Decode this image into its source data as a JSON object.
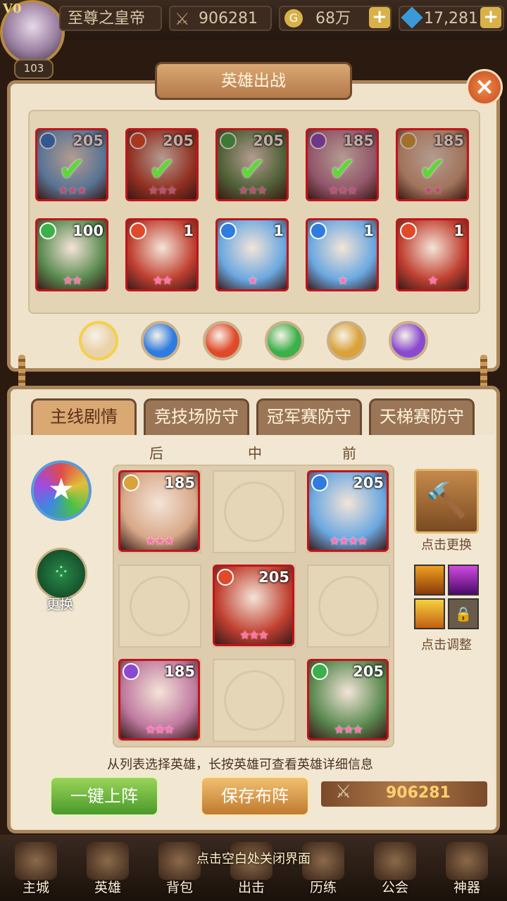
{
  "header": {
    "vip": "V0",
    "player_level": "103",
    "player_name": "至尊之皇帝",
    "power": "906281",
    "gold": "68万",
    "gems": "17,281"
  },
  "dialog": {
    "title": "英雄出战",
    "roster": [
      {
        "level": "205",
        "element": "water",
        "stars": "★★★",
        "deployed": true
      },
      {
        "level": "205",
        "element": "fire",
        "stars": "★★★",
        "deployed": true
      },
      {
        "level": "205",
        "element": "wind",
        "stars": "★★★",
        "deployed": true
      },
      {
        "level": "185",
        "element": "dark",
        "stars": "★★★",
        "deployed": true
      },
      {
        "level": "185",
        "element": "light",
        "stars": "★★",
        "deployed": true
      },
      {
        "level": "100",
        "element": "wind",
        "stars": "★★",
        "deployed": false
      },
      {
        "level": "1",
        "element": "fire",
        "stars": "★★",
        "deployed": false
      },
      {
        "level": "1",
        "element": "water",
        "stars": "★",
        "deployed": false
      },
      {
        "level": "1",
        "element": "water",
        "stars": "★",
        "deployed": false
      },
      {
        "level": "1",
        "element": "fire",
        "stars": "★",
        "deployed": false
      }
    ],
    "filters": [
      "all",
      "water",
      "fire",
      "wind",
      "light",
      "dark"
    ]
  },
  "formation": {
    "tabs": [
      "主线剧情",
      "竞技场防守",
      "冠军赛防守",
      "天梯赛防守"
    ],
    "active_tab": 0,
    "columns": [
      "后",
      "中",
      "前"
    ],
    "grid": [
      {
        "level": "185",
        "element": "light",
        "stars": "★★★"
      },
      null,
      {
        "level": "205",
        "element": "water",
        "stars": "★★★★"
      },
      null,
      {
        "level": "205",
        "element": "fire",
        "stars": "★★★"
      },
      null,
      {
        "level": "185",
        "element": "dark",
        "stars": "★★★"
      },
      null,
      {
        "level": "205",
        "element": "wind",
        "stars": "★★★"
      }
    ],
    "change_label": "更换",
    "artifact_label": "点击更换",
    "skills_label": "点击调整",
    "hint": "从列表选择英雄，长按英雄可查看英雄详细信息",
    "auto_button": "一键上阵",
    "save_button": "保存布阵",
    "power": "906281"
  },
  "close_hint": "点击空白处关闭界面",
  "nav": [
    "主城",
    "英雄",
    "背包",
    "出击",
    "历练",
    "公会",
    "神器"
  ],
  "colors": {
    "water": "#2f7be0",
    "fire": "#e04a2a",
    "wind": "#3cb04a",
    "light": "#d9a23a",
    "dark": "#8a4ad0",
    "card_red": "#c0141a"
  }
}
